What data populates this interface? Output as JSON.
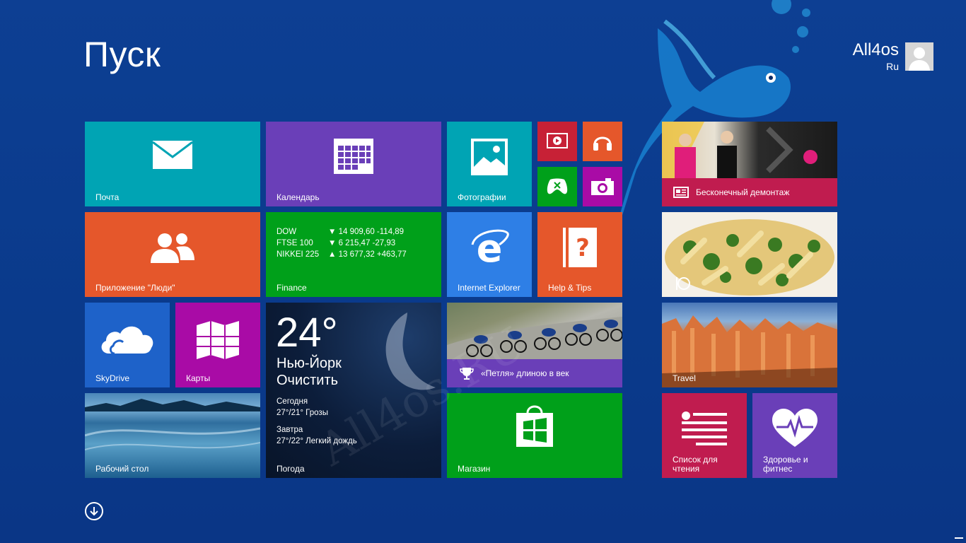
{
  "screen": {
    "title": "Пуск"
  },
  "user": {
    "name": "All4os",
    "sub": "Ru"
  },
  "tiles": {
    "mail": {
      "label": "Почта",
      "color": "#00a4b4"
    },
    "calendar": {
      "label": "Календарь",
      "color": "#6a3fb8"
    },
    "photos": {
      "label": "Фотографии",
      "color": "#00a4b4"
    },
    "video": {
      "color": "#c72136"
    },
    "music": {
      "color": "#e5572b"
    },
    "games": {
      "color": "#00a01a"
    },
    "camera": {
      "color": "#a90ba6"
    },
    "people": {
      "label": "Приложение \"Люди\"",
      "color": "#e5572b"
    },
    "finance": {
      "label": "Finance",
      "color": "#00a01a",
      "rows": [
        {
          "name": "DOW",
          "value": "▼ 14 909,60 -114,89"
        },
        {
          "name": "FTSE 100",
          "value": "▼ 6 215,47 -27,93"
        },
        {
          "name": "NIKKEI 225",
          "value": "▲ 13 677,32 +463,77"
        }
      ]
    },
    "ie": {
      "label": "Internet Explorer",
      "color": "#2e7fe6"
    },
    "help": {
      "label": "Help & Tips",
      "color": "#e5572b"
    },
    "skydrive": {
      "label": "SkyDrive",
      "color": "#1e62c9"
    },
    "maps": {
      "label": "Карты",
      "color": "#a90ba6"
    },
    "weather": {
      "label": "Погода",
      "temp": "24°",
      "city": "Нью-Йорк",
      "condition": "Очистить",
      "today_label": "Сегодня",
      "today_forecast": "27°/21° Грозы",
      "tomorrow_label": "Завтра",
      "tomorrow_forecast": "27°/22° Легкий дождь"
    },
    "sport": {
      "label": "«Петля» длиною в век",
      "color": "#6a3fb8"
    },
    "desktop": {
      "label": "Рабочий стол"
    },
    "store": {
      "label": "Магазин",
      "color": "#00a01a"
    },
    "news": {
      "label": "Бесконечный демонтаж",
      "color": "#c01c4f"
    },
    "travel": {
      "label": "Travel"
    },
    "reading": {
      "label": "Список для\nчтения",
      "line1": "Список для",
      "line2": "чтения",
      "color": "#c01c4f"
    },
    "health": {
      "line1": "Здоровье и",
      "line2": "фитнес",
      "color": "#6a3fb8"
    }
  },
  "watermark": "All4os.RU"
}
